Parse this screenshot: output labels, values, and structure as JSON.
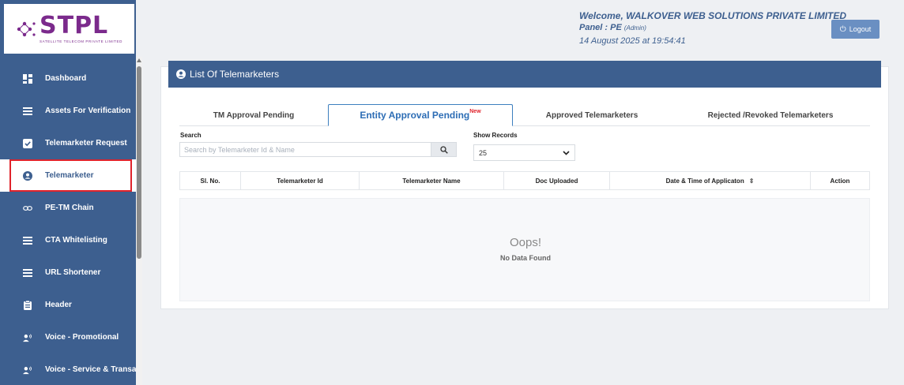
{
  "brand": {
    "name": "STPL",
    "tagline": "SATELLITE TELECOM PRIVATE LIMITED"
  },
  "header": {
    "welcome_prefix": "Welcome,",
    "company": "WALKOVER WEB SOLUTIONS PRIVATE LIMITED",
    "panel_label": "Panel : PE",
    "panel_role": "(Admin)",
    "datetime": "14 August 2025 at 19:54:41",
    "logout_label": "Logout"
  },
  "sidebar": {
    "items": [
      {
        "label": "Dashboard",
        "icon": "dashboard-icon"
      },
      {
        "label": "Assets For Verification",
        "icon": "list-icon"
      },
      {
        "label": "Telemarketer Request",
        "icon": "check-square-icon"
      },
      {
        "label": "Telemarketer",
        "icon": "user-circle-icon",
        "active": true
      },
      {
        "label": "PE-TM Chain",
        "icon": "link-icon"
      },
      {
        "label": "CTA Whitelisting",
        "icon": "list-icon"
      },
      {
        "label": "URL Shortener",
        "icon": "list-icon"
      },
      {
        "label": "Header",
        "icon": "clipboard-icon"
      },
      {
        "label": "Voice - Promotional",
        "icon": "voice-user-icon"
      },
      {
        "label": "Voice - Service & Transac",
        "icon": "voice-user-icon"
      }
    ]
  },
  "main": {
    "title": "List Of Telemarketers",
    "tabs": [
      {
        "label": "TM Approval Pending"
      },
      {
        "label": "Entity Approval Pending",
        "badge": "New",
        "active": true
      },
      {
        "label": "Approved Telemarketers"
      },
      {
        "label": "Rejected /Revoked Telemarketers"
      }
    ],
    "search": {
      "label": "Search",
      "placeholder": "Search by Telemarketer Id & Name",
      "value": ""
    },
    "show_records": {
      "label": "Show Records",
      "value": "25"
    },
    "table": {
      "columns": [
        "Sl. No.",
        "Telemarketer Id",
        "Telemarketer Name",
        "Doc Uploaded",
        "Date & Time of Applicaton",
        "Action"
      ]
    },
    "empty": {
      "title": "Oops!",
      "message": "No Data Found"
    }
  },
  "colors": {
    "primary": "#3d5f8f",
    "accent_red": "#e0232b",
    "logout": "#6a8fc2",
    "logo": "#7b2a8c"
  }
}
